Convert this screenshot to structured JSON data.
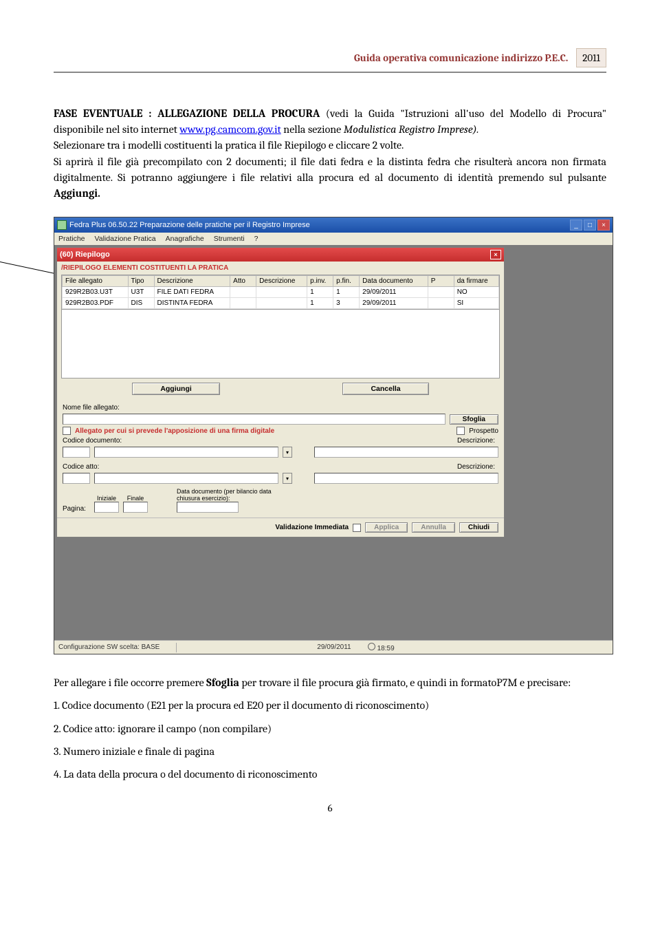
{
  "header": {
    "title": "Guida operativa comunicazione indirizzo P.E.C.",
    "year": "2011"
  },
  "para1": {
    "lead": "FASE EVENTUALE : ALLEGAZIONE DELLA PROCURA",
    "t1": " (vedi la Guida \"Istruzioni all'uso del Modello di Procura\" disponibile nel sito internet ",
    "link": "www.pg.camcom.gov.it",
    "t2": "  nella sezione ",
    "em": "Modulistica Registro Imprese).",
    "rest": "Selezionare tra i modelli costituenti la pratica il file Riepilogo e  cliccare 2 volte.",
    "p2a": "Si aprirà il file già precompilato con 2 documenti; il file dati fedra e la distinta fedra che risulterà ancora non firmata digitalmente. Si potranno aggiungere i file relativi alla procura ed al documento di identità premendo sul pulsante ",
    "p2b": "Aggiungi."
  },
  "shot": {
    "title": "Fedra Plus 06.50.22  Preparazione delle pratiche per il Registro Imprese",
    "menu": [
      "Pratiche",
      "Validazione Pratica",
      "Anagrafiche",
      "Strumenti",
      "?"
    ],
    "inner_title": "(60) Riepilogo",
    "section": "/RIEPILOGO ELEMENTI COSTITUENTI LA PRATICA",
    "cols": [
      "File allegato",
      "Tipo",
      "Descrizione",
      "Atto",
      "Descrizione",
      "p.inv.",
      "p.fin.",
      "Data documento",
      "P",
      "da firmare"
    ],
    "rows": [
      [
        "929R2B03.U3T",
        "U3T",
        "FILE DATI FEDRA",
        "",
        "",
        "1",
        "1",
        "29/09/2011",
        "",
        "NO"
      ],
      [
        "929R2B03.PDF",
        "DIS",
        "DISTINTA FEDRA",
        "",
        "",
        "1",
        "3",
        "29/09/2011",
        "",
        "SI"
      ]
    ],
    "btn_aggiungi": "Aggiungi",
    "btn_cancella": "Cancella",
    "lbl_nomefile": "Nome file allegato:",
    "btn_sfoglia": "Sfoglia",
    "chk_firma": "Allegato per cui si prevede l'apposizione di una firma digitale",
    "chk_prospetto": "Prospetto",
    "lbl_codicedoc": "Codice documento:",
    "lbl_descr": "Descrizione:",
    "lbl_codiceatto": "Codice atto:",
    "lbl_pagina": "Pagina:",
    "lbl_iniziale": "Iniziale",
    "lbl_finale": "Finale",
    "lbl_datadoc": "Data documento (per bilancio data chiusura esercizio):",
    "lbl_validazione": "Validazione Immediata",
    "btn_applica": "Applica",
    "btn_annulla": "Annulla",
    "btn_chiudi": "Chiudi",
    "status_config": "Configurazione SW scelta: BASE",
    "status_date": "29/09/2011",
    "status_time": "18:59"
  },
  "below": {
    "p1a": "Per allegare i file occorre premere ",
    "p1b": "Sfoglia",
    "p1c": " per trovare il file procura già firmato, e quindi in formatoP7M e precisare:",
    "li1": "1. Codice documento  (E21 per la procura ed E20 per il documento di riconoscimento)",
    "li2": "2. Codice atto: ignorare il campo (non compilare)",
    "li3": "3. Numero iniziale e finale di pagina",
    "li4": "4. La data della procura o del documento di riconoscimento"
  },
  "page_num": "6"
}
